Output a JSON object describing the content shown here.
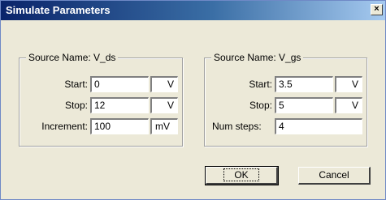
{
  "window": {
    "title": "Simulate Parameters",
    "close_glyph": "×"
  },
  "left_group": {
    "legend": "Source Name: V_ds",
    "rows": [
      {
        "label": "Start:",
        "value": "0",
        "unit": "V"
      },
      {
        "label": "Stop:",
        "value": "12",
        "unit": "V"
      },
      {
        "label": "Increment:",
        "value": "100",
        "unit": "mV"
      }
    ]
  },
  "right_group": {
    "legend": "Source Name: V_gs",
    "rows": [
      {
        "label": "Start:",
        "value": "3.5",
        "unit": "V"
      },
      {
        "label": "Stop:",
        "value": "5",
        "unit": "V"
      },
      {
        "label": "Num steps:",
        "value": "4"
      }
    ]
  },
  "buttons": {
    "ok_label": "OK",
    "cancel_label": "Cancel"
  },
  "colors": {
    "face": "#ece9d8",
    "title_start": "#0a246a",
    "title_end": "#a6caf0"
  },
  "icons": {
    "close": "close-icon"
  }
}
